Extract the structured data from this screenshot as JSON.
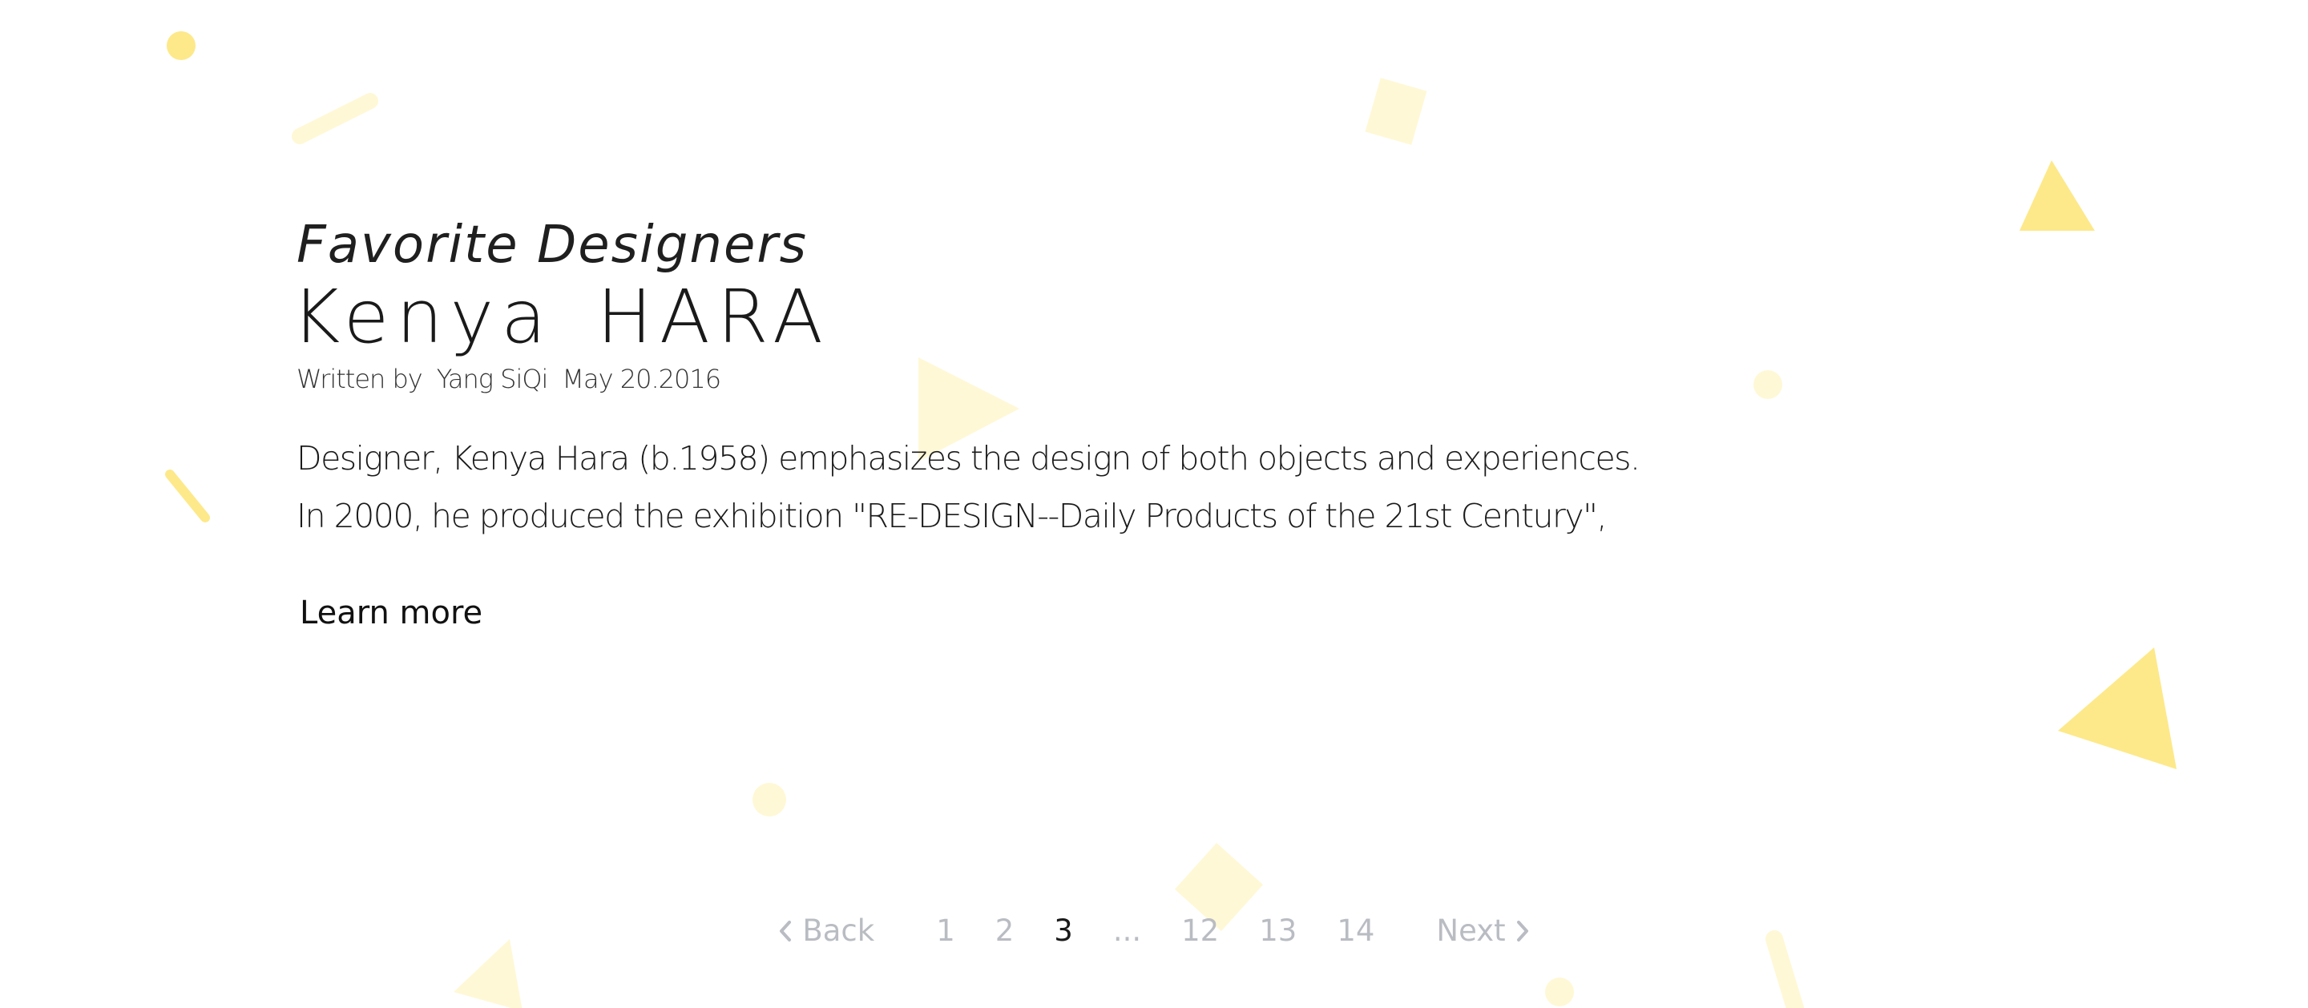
{
  "article": {
    "category": "Favorite Designers",
    "title": "Kenya  HARA",
    "byline_prefix": "Written by",
    "author": "Yang SiQi",
    "date": "May 20.2016",
    "excerpt_line1": "Designer, Kenya Hara (b.1958) emphasizes the design of both objects and experiences.",
    "excerpt_line2": "In 2000, he produced the exhibition \"RE-DESIGN--Daily Products of the 21st Century\",",
    "learn_more_label": "Learn more"
  },
  "pagination": {
    "back_label": "Back",
    "next_label": "Next",
    "pages": [
      "1",
      "2",
      "3",
      "...",
      "12",
      "13",
      "14"
    ],
    "current": "3",
    "back_icon": "chevron-left-icon",
    "next_icon": "chevron-right-icon"
  },
  "colors": {
    "decor_strong": "#fde98a",
    "decor_light": "#fff8d6",
    "pagination_text": "#b9bcc2",
    "active_text": "#1a1a1a"
  }
}
